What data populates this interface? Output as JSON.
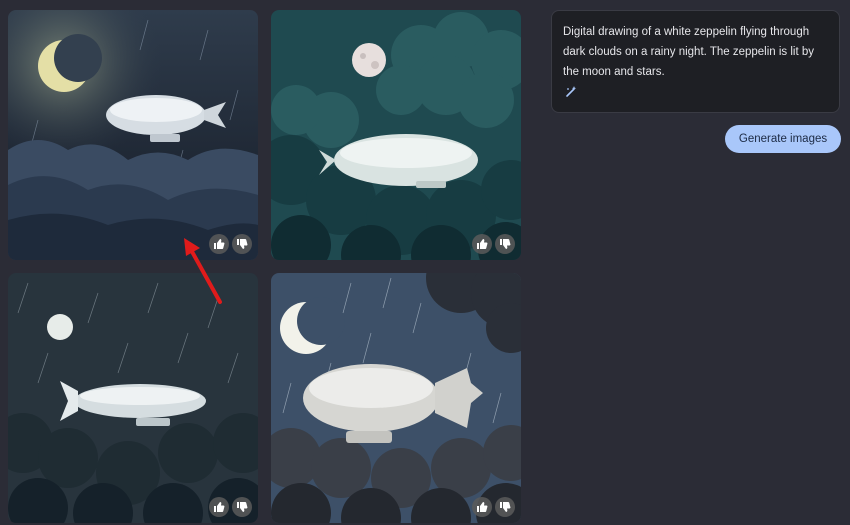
{
  "prompt": {
    "text": "Digital drawing of a white zeppelin flying through dark clouds on a rainy night. The zeppelin is lit by the moon and stars.",
    "edit_icon": "magic-wand-edit-icon"
  },
  "generate_button": {
    "label": "Generate images"
  },
  "images": [
    {
      "feedback_icons": [
        "thumbs-up-icon",
        "thumbs-down-icon"
      ]
    },
    {
      "feedback_icons": [
        "thumbs-up-icon",
        "thumbs-down-icon"
      ]
    },
    {
      "feedback_icons": [
        "thumbs-up-icon",
        "thumbs-down-icon"
      ]
    },
    {
      "feedback_icons": [
        "thumbs-up-icon",
        "thumbs-down-icon"
      ]
    }
  ],
  "annotation": {
    "color": "#e01b1b"
  },
  "colors": {
    "background": "#2b2c36",
    "button": "#a9c7fa"
  }
}
